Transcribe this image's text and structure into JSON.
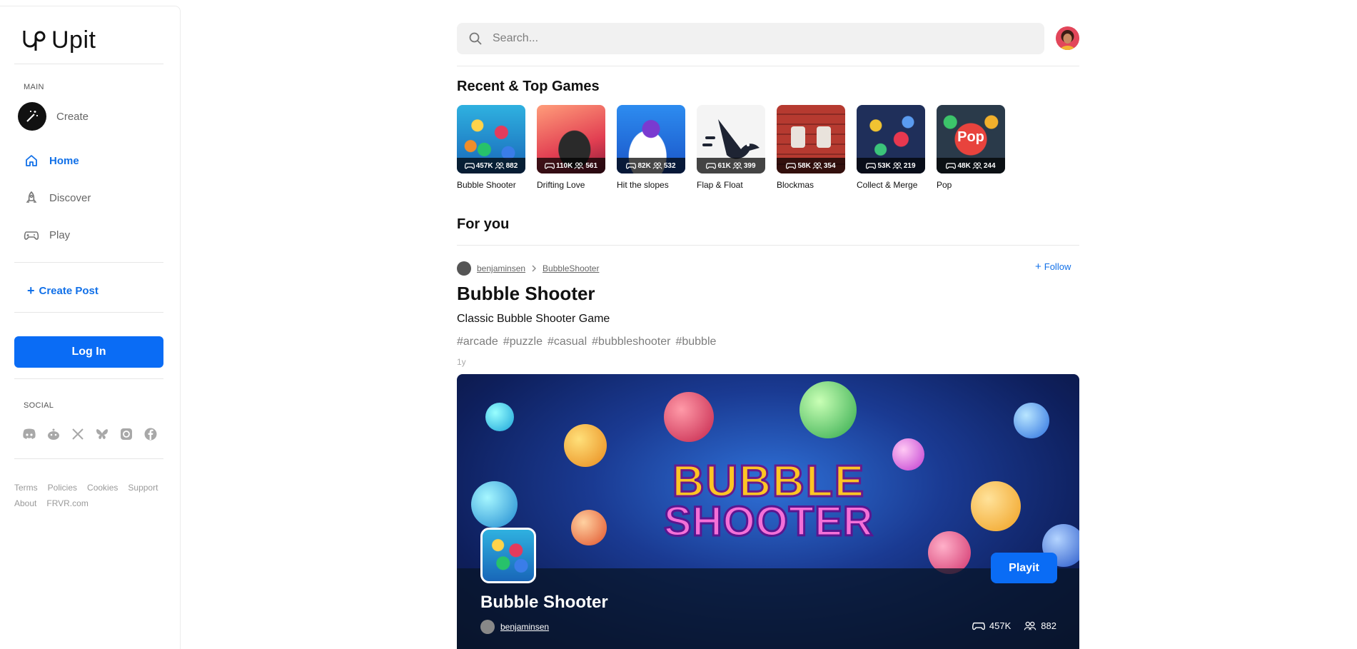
{
  "app": {
    "name": "Upit"
  },
  "sidebar": {
    "main_label": "MAIN",
    "nav": [
      {
        "label": "Create",
        "icon": "magic-wand-icon"
      },
      {
        "label": "Home",
        "icon": "home-icon"
      },
      {
        "label": "Discover",
        "icon": "rocket-icon"
      },
      {
        "label": "Play",
        "icon": "gamepad-icon"
      }
    ],
    "create_post": "Create Post",
    "login": "Log In",
    "social_label": "SOCIAL",
    "social": [
      "discord-icon",
      "reddit-icon",
      "x-icon",
      "bluesky-icon",
      "instagram-icon",
      "facebook-icon"
    ],
    "footer": [
      "Terms",
      "Policies",
      "Cookies",
      "Support",
      "About",
      "FRVR.com"
    ]
  },
  "search": {
    "placeholder": "Search..."
  },
  "sections": {
    "recent": "Recent & Top Games",
    "for_you": "For you"
  },
  "games": [
    {
      "name": "Bubble Shooter",
      "plays": "457K",
      "players": "882",
      "color": "#3aa0e8"
    },
    {
      "name": "Drifting Love",
      "plays": "110K",
      "players": "561",
      "color": "#e8504a"
    },
    {
      "name": "Hit the slopes",
      "plays": "82K",
      "players": "532",
      "color": "#2a7de0"
    },
    {
      "name": "Flap & Float",
      "plays": "61K",
      "players": "399",
      "color": "#f2f2f2"
    },
    {
      "name": "Blockmas",
      "plays": "58K",
      "players": "354",
      "color": "#c9463c"
    },
    {
      "name": "Collect & Merge",
      "plays": "53K",
      "players": "219",
      "color": "#2a3d6e"
    },
    {
      "name": "Pop",
      "plays": "48K",
      "players": "244",
      "color": "#e9463f"
    }
  ],
  "post": {
    "author": "benjaminsen",
    "channel": "BubbleShooter",
    "follow": "Follow",
    "title": "Bubble Shooter",
    "description": "Classic Bubble Shooter Game",
    "tags": [
      "#arcade",
      "#puzzle",
      "#casual",
      "#bubbleshooter",
      "#bubble"
    ],
    "age": "1y",
    "hero": {
      "art_line1": "BUBBLE",
      "art_line2": "SHOOTER",
      "name": "Bubble Shooter",
      "author": "benjaminsen",
      "play_label": "Playit",
      "plays": "457K",
      "players": "882"
    }
  }
}
